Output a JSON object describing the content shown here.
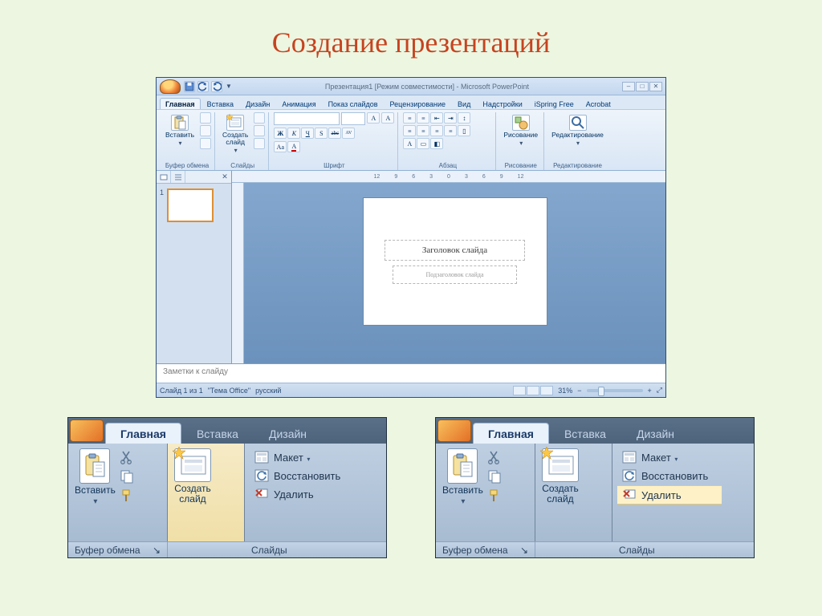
{
  "page_title": "Создание презентаций",
  "window": {
    "title": "Презентация1 [Режим совместимости] - Microsoft PowerPoint",
    "tabs": [
      "Главная",
      "Вставка",
      "Дизайн",
      "Анимация",
      "Показ слайдов",
      "Рецензирование",
      "Вид",
      "Надстройки",
      "iSpring Free",
      "Acrobat"
    ],
    "active_tab": "Главная",
    "ribbon": {
      "clipboard": {
        "label": "Буфер обмена",
        "paste": "Вставить"
      },
      "slides": {
        "label": "Слайды",
        "new_slide": "Создать\nслайд"
      },
      "font": {
        "label": "Шрифт",
        "font_name": "",
        "font_size": "",
        "btns": [
          "Ж",
          "К",
          "Ч",
          "S",
          "abc",
          "AV"
        ]
      },
      "paragraph": {
        "label": "Абзац"
      },
      "drawing": {
        "label": "Рисование",
        "btn": "Рисование"
      },
      "editing": {
        "label": "Редактирование",
        "btn": "Редактирование"
      }
    },
    "ruler_marks": [
      "12",
      "9",
      "6",
      "3",
      "0",
      "3",
      "6",
      "9",
      "12"
    ],
    "slide": {
      "title": "Заголовок слайда",
      "subtitle": "Подзаголовок слайда"
    },
    "notes_placeholder": "Заметки к слайду",
    "status": {
      "slide_no": "Слайд 1 из 1",
      "theme": "\"Тема Office\"",
      "lang": "русский",
      "zoom": "31%"
    },
    "thumb_number": "1"
  },
  "zoomA": {
    "tabs": [
      "Главная",
      "Вставка",
      "Дизайн"
    ],
    "paste": "Вставить",
    "new_slide": "Создать\nслайд",
    "menu": {
      "layout": "Макет",
      "reset": "Восстановить",
      "delete": "Удалить"
    },
    "footer": {
      "clipboard": "Буфер обмена",
      "slides": "Слайды"
    }
  },
  "zoomB": {
    "tabs": [
      "Главная",
      "Вставка",
      "Дизайн"
    ],
    "paste": "Вставить",
    "new_slide": "Создать\nслайд",
    "menu": {
      "layout": "Макет",
      "reset": "Восстановить",
      "delete": "Удалить"
    },
    "footer": {
      "clipboard": "Буфер обмена",
      "slides": "Слайды"
    }
  }
}
